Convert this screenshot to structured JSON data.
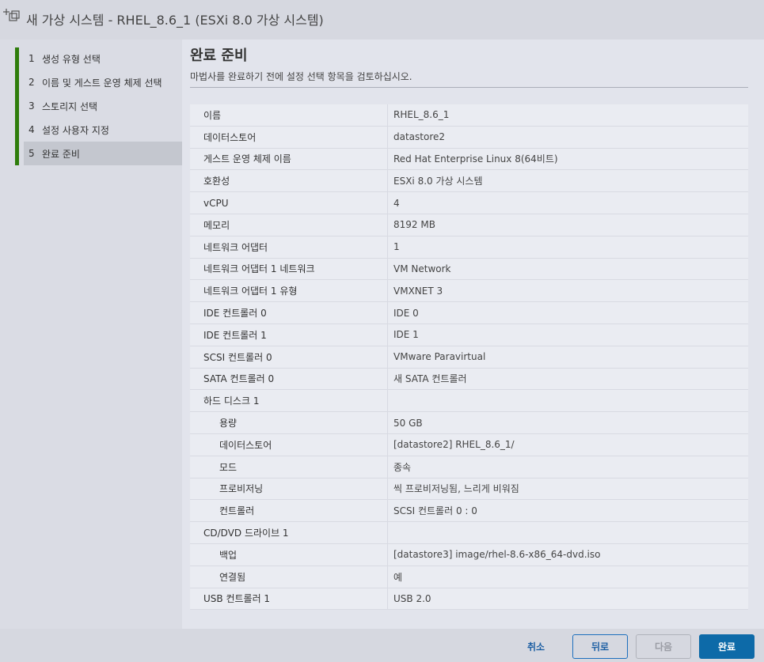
{
  "window": {
    "title": "새 가상 시스템 - RHEL_8.6_1 (ESXi 8.0 가상 시스템)"
  },
  "steps": [
    {
      "num": "1",
      "label": "생성 유형 선택"
    },
    {
      "num": "2",
      "label": "이름 및 게스트 운영 체제 선택"
    },
    {
      "num": "3",
      "label": "스토리지 선택"
    },
    {
      "num": "4",
      "label": "설정 사용자 지정"
    },
    {
      "num": "5",
      "label": "완료 준비"
    }
  ],
  "main": {
    "title": "완료 준비",
    "subtitle": "마법사를 완료하기 전에 설정 선택 항목을 검토하십시오."
  },
  "summary": [
    {
      "key": "이름",
      "value": "RHEL_8.6_1"
    },
    {
      "key": "데이터스토어",
      "value": "datastore2"
    },
    {
      "key": "게스트 운영 체제 이름",
      "value": "Red Hat Enterprise Linux 8(64비트)"
    },
    {
      "key": "호환성",
      "value": "ESXi 8.0 가상 시스템"
    },
    {
      "key": "vCPU",
      "value": "4"
    },
    {
      "key": "메모리",
      "value": "8192 MB"
    },
    {
      "key": "네트워크 어댑터",
      "value": "1"
    },
    {
      "key": "네트워크 어댑터 1 네트워크",
      "value": "VM Network"
    },
    {
      "key": "네트워크 어댑터 1 유형",
      "value": "VMXNET 3"
    },
    {
      "key": "IDE 컨트롤러 0",
      "value": "IDE 0"
    },
    {
      "key": "IDE 컨트롤러 1",
      "value": "IDE 1"
    },
    {
      "key": "SCSI 컨트롤러 0",
      "value": "VMware Paravirtual"
    },
    {
      "key": "SATA 컨트롤러 0",
      "value": "새 SATA 컨트롤러"
    },
    {
      "key": "하드 디스크 1",
      "value": ""
    },
    {
      "key": "용량",
      "value": "50 GB"
    },
    {
      "key": "데이터스토어",
      "value": "[datastore2] RHEL_8.6_1/"
    },
    {
      "key": "모드",
      "value": "종속"
    },
    {
      "key": "프로비저닝",
      "value": "씩 프로비저닝됨, 느리게 비워짐"
    },
    {
      "key": "컨트롤러",
      "value": "SCSI 컨트롤러 0 : 0"
    },
    {
      "key": "CD/DVD 드라이브 1",
      "value": ""
    },
    {
      "key": "백업",
      "value": "[datastore3] image/rhel-8.6-x86_64-dvd.iso"
    },
    {
      "key": "연결됨",
      "value": "예"
    },
    {
      "key": "USB 컨트롤러 1",
      "value": "USB 2.0"
    }
  ],
  "buttons": {
    "cancel": "취소",
    "back": "뒤로",
    "next": "다음",
    "finish": "완료"
  },
  "colors": {
    "accent_green": "#2e7d0b",
    "primary_button": "#0d6aa8",
    "link_blue": "#1d5fa3"
  }
}
